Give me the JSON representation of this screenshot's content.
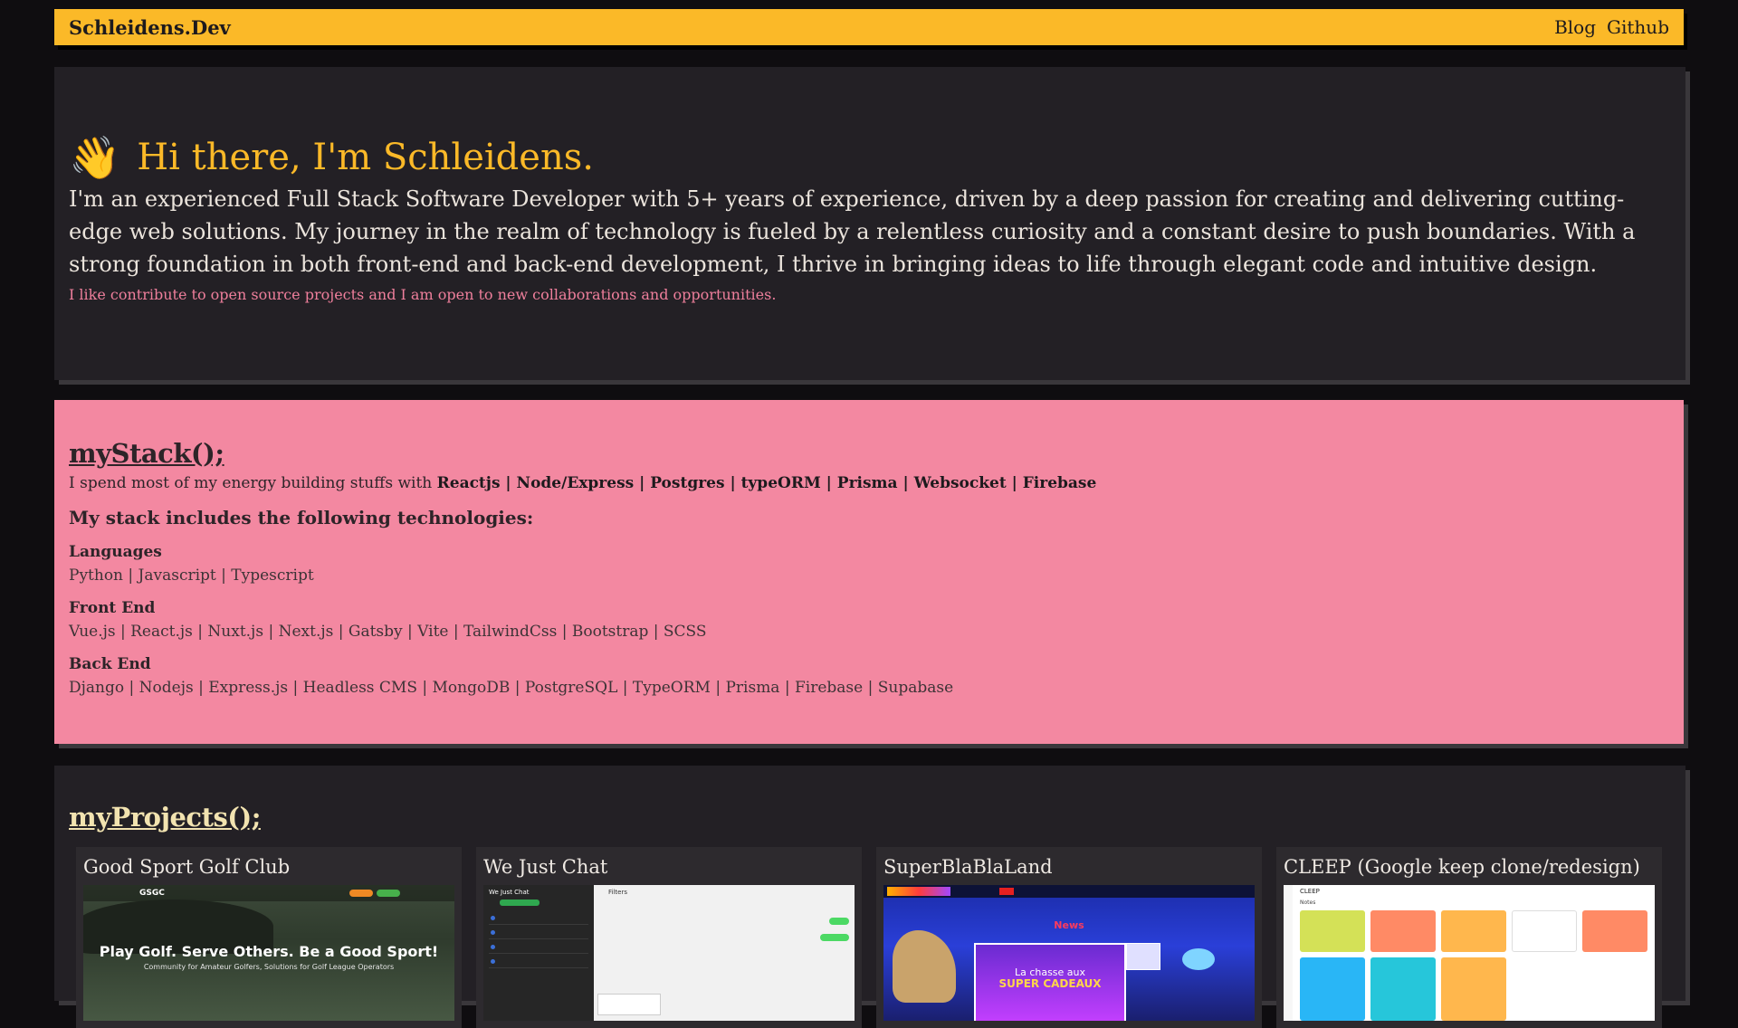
{
  "nav": {
    "brand": "Schleidens.Dev",
    "links": [
      "Blog",
      "Github"
    ]
  },
  "hero": {
    "wave_emoji": "👋",
    "title": "Hi there, I'm Schleidens.",
    "intro": "I'm an experienced Full Stack Software Developer with 5+ years of experience, driven by a deep passion for creating and delivering cutting-edge web solutions. My journey in the realm of technology is fueled by a relentless curiosity and a constant desire to push boundaries. With a strong foundation in both front-end and back-end development, I thrive in bringing ideas to life through elegant code and intuitive design.",
    "collab": "I like contribute to open source projects and I am open to new collaborations and opportunities."
  },
  "stack": {
    "title": "myStack();",
    "lead": "I spend most of my energy building stuffs with",
    "highlight": "Reactjs | Node/Express | Postgres | typeORM | Prisma | Websocket | Firebase",
    "heading": "My stack includes the following technologies:",
    "categories": [
      {
        "title": "Languages",
        "items": "Python | Javascript | Typescript"
      },
      {
        "title": "Front End",
        "items": "Vue.js | React.js | Nuxt.js | Next.js | Gatsby | Vite | TailwindCss | Bootstrap | SCSS"
      },
      {
        "title": "Back End",
        "items": "Django | Nodejs | Express.js | Headless CMS | MongoDB | PostgreSQL | TypeORM | Prisma | Firebase | Supabase"
      }
    ]
  },
  "projects": {
    "title": "myProjects();",
    "items": [
      {
        "title": "Good Sport Golf Club",
        "thumb": {
          "logo": "GSGC",
          "headline": "Play Golf. Serve Others. Be a Good Sport!",
          "sub": "Community for Amateur Golfers, Solutions for Golf League Operators"
        }
      },
      {
        "title": "We Just Chat",
        "thumb": {
          "side_title": "We Just Chat",
          "main_title": "Filters"
        }
      },
      {
        "title": "SuperBlaBlaLand",
        "thumb": {
          "news": "News",
          "banner1": "La chasse aux",
          "banner2": "SUPER CADEAUX"
        }
      },
      {
        "title": "CLEEP (Google keep clone/redesign)",
        "thumb": {
          "app_title": "CLEEP",
          "section": "Notes"
        }
      }
    ]
  },
  "colors": {
    "accent_yellow": "#fbb928",
    "pink_panel": "#f388a1",
    "dark_panel": "#232025",
    "background": "#0f0d10"
  }
}
